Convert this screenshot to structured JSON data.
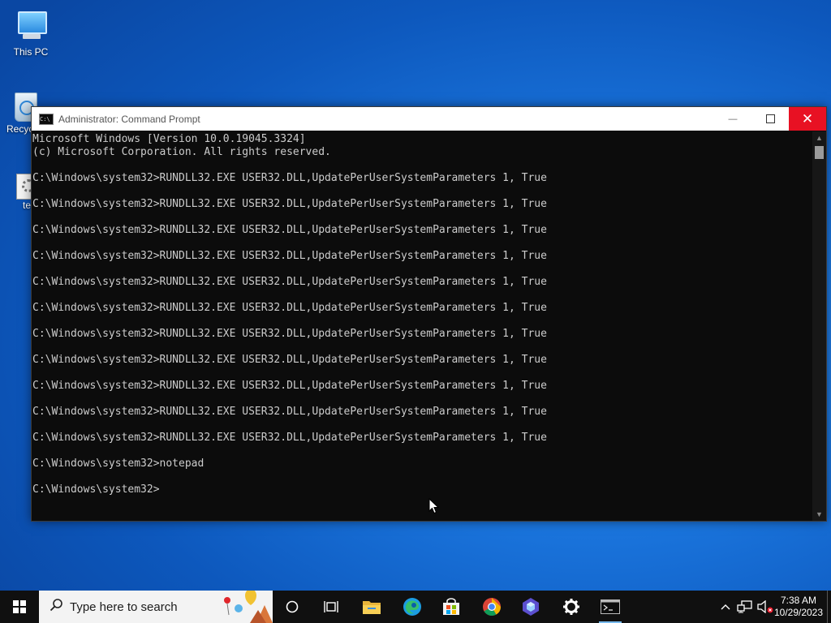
{
  "desktop": {
    "icons": [
      {
        "label": "This PC"
      },
      {
        "label": "Recyc"
      },
      {
        "label": "te"
      }
    ]
  },
  "window": {
    "title": "Administrator: Command Prompt",
    "controls": {
      "minimize": "—",
      "close": "✕"
    },
    "console_lines": [
      "Microsoft Windows [Version 10.0.19045.3324]",
      "(c) Microsoft Corporation. All rights reserved.",
      "",
      "C:\\Windows\\system32>RUNDLL32.EXE USER32.DLL,UpdatePerUserSystemParameters 1, True",
      "",
      "C:\\Windows\\system32>RUNDLL32.EXE USER32.DLL,UpdatePerUserSystemParameters 1, True",
      "",
      "C:\\Windows\\system32>RUNDLL32.EXE USER32.DLL,UpdatePerUserSystemParameters 1, True",
      "",
      "C:\\Windows\\system32>RUNDLL32.EXE USER32.DLL,UpdatePerUserSystemParameters 1, True",
      "",
      "C:\\Windows\\system32>RUNDLL32.EXE USER32.DLL,UpdatePerUserSystemParameters 1, True",
      "",
      "C:\\Windows\\system32>RUNDLL32.EXE USER32.DLL,UpdatePerUserSystemParameters 1, True",
      "",
      "C:\\Windows\\system32>RUNDLL32.EXE USER32.DLL,UpdatePerUserSystemParameters 1, True",
      "",
      "C:\\Windows\\system32>RUNDLL32.EXE USER32.DLL,UpdatePerUserSystemParameters 1, True",
      "",
      "C:\\Windows\\system32>RUNDLL32.EXE USER32.DLL,UpdatePerUserSystemParameters 1, True",
      "",
      "C:\\Windows\\system32>RUNDLL32.EXE USER32.DLL,UpdatePerUserSystemParameters 1, True",
      "",
      "C:\\Windows\\system32>RUNDLL32.EXE USER32.DLL,UpdatePerUserSystemParameters 1, True",
      "",
      "C:\\Windows\\system32>notepad",
      "",
      "C:\\Windows\\system32>"
    ]
  },
  "taskbar": {
    "search_placeholder": "Type here to search",
    "apps": [
      {
        "name": "cortana-icon"
      },
      {
        "name": "task-view-icon"
      },
      {
        "name": "file-explorer-icon"
      },
      {
        "name": "edge-icon"
      },
      {
        "name": "store-icon"
      },
      {
        "name": "chrome-icon"
      },
      {
        "name": "app-icon"
      },
      {
        "name": "settings-icon"
      },
      {
        "name": "command-prompt-icon"
      }
    ],
    "clock": {
      "time": "7:38 AM",
      "date": "10/29/2023"
    }
  },
  "colors": {
    "console_bg": "#0c0c0c",
    "console_text": "#cccccc",
    "close_red": "#e81123",
    "taskbar_bg": "#101010",
    "desktop_blue": "#1a74dc"
  }
}
